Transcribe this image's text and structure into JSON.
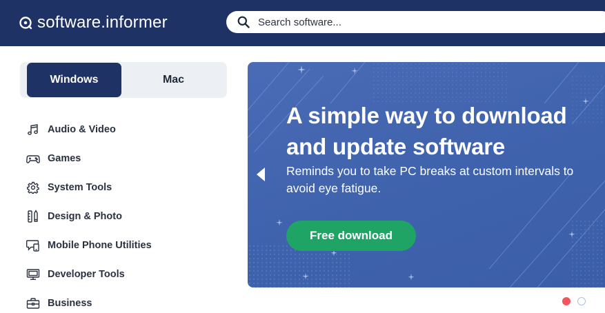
{
  "header": {
    "logo_text": "software.informer",
    "search": {
      "placeholder": "Search software..."
    }
  },
  "os_toggle": {
    "options": [
      {
        "label": "Windows",
        "selected": true
      },
      {
        "label": "Mac",
        "selected": false
      }
    ]
  },
  "categories": [
    {
      "label": "Audio & Video",
      "icon": "music-note-icon"
    },
    {
      "label": "Games",
      "icon": "gamepad-icon"
    },
    {
      "label": "System Tools",
      "icon": "gear-icon"
    },
    {
      "label": "Design & Photo",
      "icon": "design-tools-icon"
    },
    {
      "label": "Mobile Phone Utilities",
      "icon": "mobile-chat-icon"
    },
    {
      "label": "Developer Tools",
      "icon": "monitor-icon"
    },
    {
      "label": "Business",
      "icon": "briefcase-icon"
    }
  ],
  "banner": {
    "title": "A simple way to download and update software",
    "description": "Reminds you to take PC breaks at custom intervals to avoid eye fatigue.",
    "cta_label": "Free download",
    "slide_count": 2,
    "active_slide": 1
  },
  "colors": {
    "header_bg": "#1f3266",
    "banner_bg": "#4263ae",
    "cta_bg": "#1fa466",
    "active_dot": "#f0585d"
  }
}
